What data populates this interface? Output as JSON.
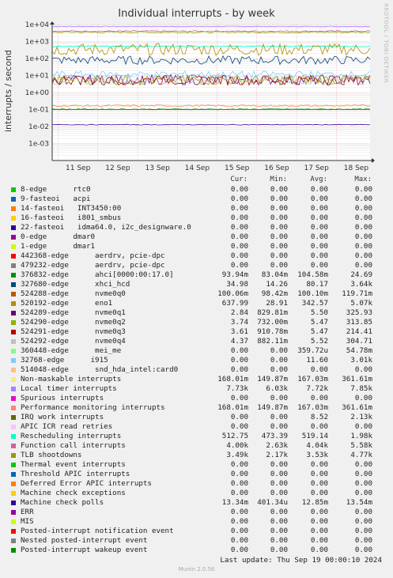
{
  "title": "Individual interrupts - by week",
  "watermark": "RRDTOOL / TOBI OETIKER",
  "footer": "Munin 2.0.56",
  "last_update": "Last update: Thu Sep 19 00:00:10 2024",
  "legend_header": {
    "cur": "Cur:",
    "min": "Min:",
    "avg": "Avg:",
    "max": "Max:"
  },
  "rows": [
    {
      "name": "8-edge      rtc0",
      "color": "#00cc00",
      "cur": "0.00",
      "min": "0.00",
      "avg": "0.00",
      "max": "0.00"
    },
    {
      "name": "9-fasteoi   acpi",
      "color": "#0066b3",
      "cur": "0.00",
      "min": "0.00",
      "avg": "0.00",
      "max": "0.00"
    },
    {
      "name": "14-fasteoi   INT3450:00",
      "color": "#ff8000",
      "cur": "0.00",
      "min": "0.00",
      "avg": "0.00",
      "max": "0.00"
    },
    {
      "name": "16-fasteoi   i801_smbus",
      "color": "#ffcc00",
      "cur": "0.00",
      "min": "0.00",
      "avg": "0.00",
      "max": "0.00"
    },
    {
      "name": "22-fasteoi   idma64.0, i2c_designware.0",
      "color": "#330099",
      "cur": "0.00",
      "min": "0.00",
      "avg": "0.00",
      "max": "0.00"
    },
    {
      "name": "0-edge      dmar0",
      "color": "#990099",
      "cur": "0.00",
      "min": "0.00",
      "avg": "0.00",
      "max": "0.00"
    },
    {
      "name": "1-edge      dmar1",
      "color": "#ccff00",
      "cur": "0.00",
      "min": "0.00",
      "avg": "0.00",
      "max": "0.00"
    },
    {
      "name": "442368-edge      aerdrv, pcie-dpc",
      "color": "#ff0000",
      "cur": "0.00",
      "min": "0.00",
      "avg": "0.00",
      "max": "0.00"
    },
    {
      "name": "479232-edge      aerdrv, pcie-dpc",
      "color": "#808080",
      "cur": "0.00",
      "min": "0.00",
      "avg": "0.00",
      "max": "0.00"
    },
    {
      "name": "376832-edge      ahci[0000:00:17.0]",
      "color": "#008f00",
      "cur": "93.94m",
      "min": "83.04m",
      "avg": "104.58m",
      "max": "24.69"
    },
    {
      "name": "327680-edge      xhci_hcd",
      "color": "#00487d",
      "cur": "34.98",
      "min": "14.26",
      "avg": "80.17",
      "max": "3.64k"
    },
    {
      "name": "524288-edge      nvme0q0",
      "color": "#b35a00",
      "cur": "100.06m",
      "min": "98.42m",
      "avg": "100.10m",
      "max": "119.71m"
    },
    {
      "name": "520192-edge      eno1",
      "color": "#b38f00",
      "cur": "637.99",
      "min": "28.91",
      "avg": "342.57",
      "max": "5.07k"
    },
    {
      "name": "524289-edge      nvme0q1",
      "color": "#6b006b",
      "cur": "2.84",
      "min": "829.81m",
      "avg": "5.50",
      "max": "325.93"
    },
    {
      "name": "524290-edge      nvme0q2",
      "color": "#8fb300",
      "cur": "3.74",
      "min": "732.00m",
      "avg": "5.47",
      "max": "313.85"
    },
    {
      "name": "524291-edge      nvme0q3",
      "color": "#b30000",
      "cur": "3.61",
      "min": "910.78m",
      "avg": "5.47",
      "max": "214.41"
    },
    {
      "name": "524292-edge      nvme0q4",
      "color": "#bebebe",
      "cur": "4.37",
      "min": "882.11m",
      "avg": "5.52",
      "max": "304.71"
    },
    {
      "name": "360448-edge      mei_me",
      "color": "#80ff80",
      "cur": "0.00",
      "min": "0.00",
      "avg": "359.72u",
      "max": "54.78m"
    },
    {
      "name": "32768-edge      i915",
      "color": "#80c9ff",
      "cur": "0.00",
      "min": "0.00",
      "avg": "11.60",
      "max": "3.01k"
    },
    {
      "name": "514048-edge      snd_hda_intel:card0",
      "color": "#ffc080",
      "cur": "0.00",
      "min": "0.00",
      "avg": "0.00",
      "max": "0.00"
    },
    {
      "name": "Non-maskable interrupts",
      "color": "#ffe680",
      "cur": "168.01m",
      "min": "149.87m",
      "avg": "167.03m",
      "max": "361.61m"
    },
    {
      "name": "Local timer interrupts",
      "color": "#aa80ff",
      "cur": "7.73k",
      "min": "6.03k",
      "avg": "7.72k",
      "max": "7.85k"
    },
    {
      "name": "Spurious interrupts",
      "color": "#ee00cc",
      "cur": "0.00",
      "min": "0.00",
      "avg": "0.00",
      "max": "0.00"
    },
    {
      "name": "Performance monitoring interrupts",
      "color": "#ff8080",
      "cur": "168.01m",
      "min": "149.87m",
      "avg": "167.03m",
      "max": "361.61m"
    },
    {
      "name": "IRQ work interrupts",
      "color": "#666600",
      "cur": "0.00",
      "min": "0.00",
      "avg": "8.52",
      "max": "2.13k"
    },
    {
      "name": "APIC ICR read retries",
      "color": "#ffbfff",
      "cur": "0.00",
      "min": "0.00",
      "avg": "0.00",
      "max": "0.00"
    },
    {
      "name": "Rescheduling interrupts",
      "color": "#00ffcc",
      "cur": "512.75",
      "min": "473.39",
      "avg": "519.14",
      "max": "1.98k"
    },
    {
      "name": "Function call interrupts",
      "color": "#cc6699",
      "cur": "4.00k",
      "min": "2.63k",
      "avg": "4.04k",
      "max": "5.58k"
    },
    {
      "name": "TLB shootdowns",
      "color": "#999900",
      "cur": "3.49k",
      "min": "2.17k",
      "avg": "3.53k",
      "max": "4.77k"
    },
    {
      "name": "Thermal event interrupts",
      "color": "#00cc00",
      "cur": "0.00",
      "min": "0.00",
      "avg": "0.00",
      "max": "0.00"
    },
    {
      "name": "Threshold APIC interrupts",
      "color": "#0066b3",
      "cur": "0.00",
      "min": "0.00",
      "avg": "0.00",
      "max": "0.00"
    },
    {
      "name": "Deferred Error APIC interrupts",
      "color": "#ff8000",
      "cur": "0.00",
      "min": "0.00",
      "avg": "0.00",
      "max": "0.00"
    },
    {
      "name": "Machine check exceptions",
      "color": "#ffcc00",
      "cur": "0.00",
      "min": "0.00",
      "avg": "0.00",
      "max": "0.00"
    },
    {
      "name": "Machine check polls",
      "color": "#330099",
      "cur": "13.34m",
      "min": "401.34u",
      "avg": "12.85m",
      "max": "13.54m"
    },
    {
      "name": "ERR",
      "color": "#990099",
      "cur": "0.00",
      "min": "0.00",
      "avg": "0.00",
      "max": "0.00"
    },
    {
      "name": "MIS",
      "color": "#ccff00",
      "cur": "0.00",
      "min": "0.00",
      "avg": "0.00",
      "max": "0.00"
    },
    {
      "name": "Posted-interrupt notification event",
      "color": "#ff0000",
      "cur": "0.00",
      "min": "0.00",
      "avg": "0.00",
      "max": "0.00"
    },
    {
      "name": "Nested posted-interrupt event",
      "color": "#808080",
      "cur": "0.00",
      "min": "0.00",
      "avg": "0.00",
      "max": "0.00"
    },
    {
      "name": "Posted-interrupt wakeup event",
      "color": "#008f00",
      "cur": "0.00",
      "min": "0.00",
      "avg": "0.00",
      "max": "0.00"
    }
  ],
  "chart_data": {
    "type": "line",
    "title": "Individual interrupts - by week",
    "ylabel": "interrupts / second",
    "yscale": "log",
    "ylim": [
      0.0001,
      10000
    ],
    "yticks": [
      "1e-03",
      "1e-02",
      "1e-01",
      "1e+00",
      "1e+01",
      "1e+02",
      "1e+03",
      "1e+04"
    ],
    "xticks": [
      "11 Sep",
      "12 Sep",
      "13 Sep",
      "14 Sep",
      "15 Sep",
      "16 Sep",
      "17 Sep",
      "18 Sep"
    ],
    "grid": true,
    "series": [
      {
        "name": "Local timer interrupts",
        "color": "#aa80ff",
        "level": 7720,
        "noise": 0.02
      },
      {
        "name": "Function call interrupts",
        "color": "#cc6699",
        "level": 4040,
        "noise": 0.04
      },
      {
        "name": "TLB shootdowns",
        "color": "#999900",
        "level": 3530,
        "noise": 0.04
      },
      {
        "name": "Rescheduling interrupts",
        "color": "#00ffcc",
        "level": 519.14,
        "noise": 0.03
      },
      {
        "name": "520192-edge      eno1",
        "color": "#b38f00",
        "level": 342.57,
        "noise": 0.35
      },
      {
        "name": "327680-edge      xhci_hcd",
        "color": "#00487d",
        "level": 80.17,
        "noise": 0.25
      },
      {
        "name": "524289-edge      nvme0q1",
        "color": "#6b006b",
        "level": 5.5,
        "noise": 0.3
      },
      {
        "name": "524290-edge      nvme0q2",
        "color": "#8fb300",
        "level": 5.47,
        "noise": 0.3
      },
      {
        "name": "524291-edge      nvme0q3",
        "color": "#b30000",
        "level": 5.47,
        "noise": 0.3
      },
      {
        "name": "524292-edge      nvme0q4",
        "color": "#bebebe",
        "level": 5.52,
        "noise": 0.3
      },
      {
        "name": "Non-maskable interrupts",
        "color": "#ffe680",
        "level": 0.167,
        "noise": 0.05
      },
      {
        "name": "Performance monitoring interrupts",
        "color": "#ff8080",
        "level": 0.167,
        "noise": 0.05
      },
      {
        "name": "524288-edge      nvme0q0",
        "color": "#b35a00",
        "level": 0.1001,
        "noise": 0.01
      },
      {
        "name": "376832-edge      ahci[0000:00:17.0]",
        "color": "#008f00",
        "level": 0.1046,
        "noise": 0.02
      },
      {
        "name": "Machine check polls",
        "color": "#330099",
        "level": 0.01285,
        "noise": 0.02
      },
      {
        "name": "32768-edge      i915",
        "color": "#80c9ff",
        "level": 11.6,
        "noise": 0.2
      }
    ]
  }
}
